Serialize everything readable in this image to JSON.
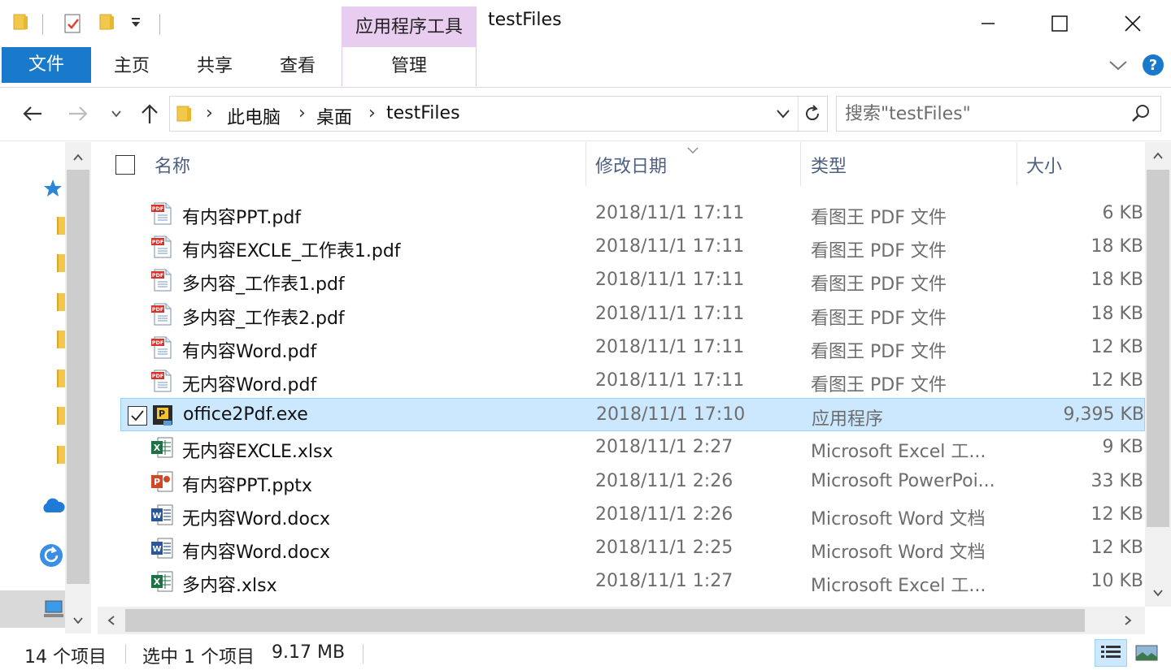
{
  "window": {
    "title": "testFiles",
    "context_tab_title": "应用程序工具"
  },
  "ribbon": {
    "tabs": [
      {
        "label": "文件"
      },
      {
        "label": "主页"
      },
      {
        "label": "共享"
      },
      {
        "label": "查看"
      },
      {
        "label": "管理"
      }
    ]
  },
  "address": {
    "crumbs": [
      "此电脑",
      "桌面",
      "testFiles"
    ]
  },
  "search": {
    "placeholder": "搜索\"testFiles\""
  },
  "columns": {
    "name": "名称",
    "date": "修改日期",
    "type": "类型",
    "size": "大小"
  },
  "files": [
    {
      "name": "有内容PPT.pdf",
      "date": "2018/11/1 17:11",
      "type": "看图王 PDF 文件",
      "size": "6 KB",
      "icon": "pdf-file-icon"
    },
    {
      "name": "有内容EXCLE_工作表1.pdf",
      "date": "2018/11/1 17:11",
      "type": "看图王 PDF 文件",
      "size": "18 KB",
      "icon": "pdf-file-icon"
    },
    {
      "name": "多内容_工作表1.pdf",
      "date": "2018/11/1 17:11",
      "type": "看图王 PDF 文件",
      "size": "18 KB",
      "icon": "pdf-file-icon"
    },
    {
      "name": "多内容_工作表2.pdf",
      "date": "2018/11/1 17:11",
      "type": "看图王 PDF 文件",
      "size": "18 KB",
      "icon": "pdf-file-icon"
    },
    {
      "name": "有内容Word.pdf",
      "date": "2018/11/1 17:11",
      "type": "看图王 PDF 文件",
      "size": "12 KB",
      "icon": "pdf-file-icon"
    },
    {
      "name": "无内容Word.pdf",
      "date": "2018/11/1 17:11",
      "type": "看图王 PDF 文件",
      "size": "12 KB",
      "icon": "pdf-file-icon"
    },
    {
      "name": "office2Pdf.exe",
      "date": "2018/11/1 17:10",
      "type": "应用程序",
      "size": "9,395 KB",
      "icon": "exe-file-icon",
      "selected": true
    },
    {
      "name": "无内容EXCLE.xlsx",
      "date": "2018/11/1 2:27",
      "type": "Microsoft Excel 工...",
      "size": "9 KB",
      "icon": "excel-file-icon"
    },
    {
      "name": "有内容PPT.pptx",
      "date": "2018/11/1 2:26",
      "type": "Microsoft PowerPoi...",
      "size": "33 KB",
      "icon": "powerpoint-file-icon"
    },
    {
      "name": "无内容Word.docx",
      "date": "2018/11/1 2:26",
      "type": "Microsoft Word 文档",
      "size": "12 KB",
      "icon": "word-file-icon"
    },
    {
      "name": "有内容Word.docx",
      "date": "2018/11/1 2:25",
      "type": "Microsoft Word 文档",
      "size": "12 KB",
      "icon": "word-file-icon"
    },
    {
      "name": "多内容.xlsx",
      "date": "2018/11/1 1:27",
      "type": "Microsoft Excel 工...",
      "size": "10 KB",
      "icon": "excel-file-icon"
    }
  ],
  "status": {
    "item_count": "14 个项目",
    "selection": "选中 1 个项目",
    "selection_size": "9.17 MB"
  },
  "colors": {
    "accent": "#1979ca",
    "selection_bg": "#cce8ff",
    "selection_border": "#99d1ff",
    "context_tab": "#e8cdf0",
    "header_text": "#4d6082"
  }
}
